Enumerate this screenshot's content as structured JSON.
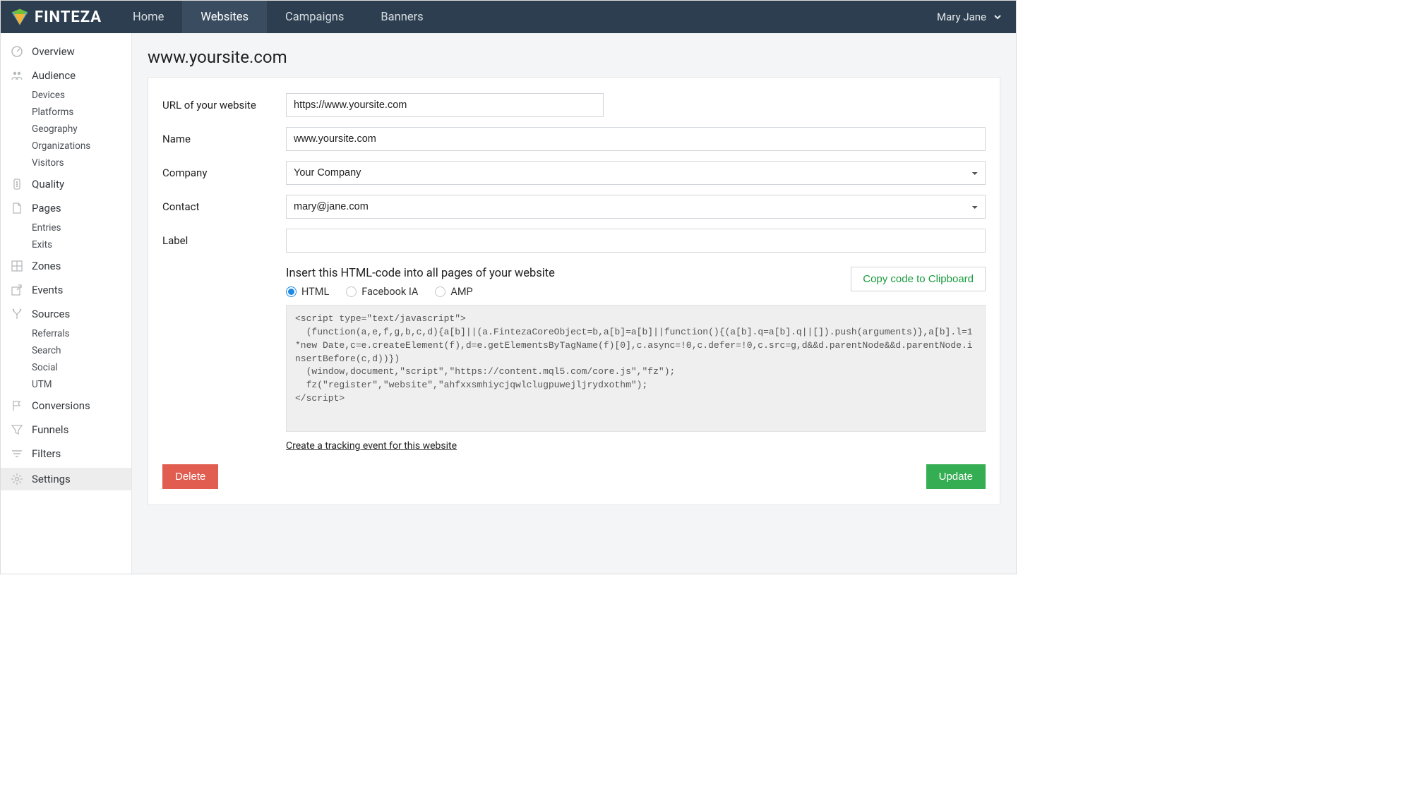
{
  "brand": "FINTEZA",
  "nav": {
    "home": "Home",
    "websites": "Websites",
    "campaigns": "Campaigns",
    "banners": "Banners"
  },
  "user": {
    "name": "Mary Jane"
  },
  "sidebar": {
    "overview": "Overview",
    "audience": "Audience",
    "audience_subs": {
      "devices": "Devices",
      "platforms": "Platforms",
      "geography": "Geography",
      "organizations": "Organizations",
      "visitors": "Visitors"
    },
    "quality": "Quality",
    "pages": "Pages",
    "pages_subs": {
      "entries": "Entries",
      "exits": "Exits"
    },
    "zones": "Zones",
    "events": "Events",
    "sources": "Sources",
    "sources_subs": {
      "referrals": "Referrals",
      "search": "Search",
      "social": "Social",
      "utm": "UTM"
    },
    "conversions": "Conversions",
    "funnels": "Funnels",
    "filters": "Filters",
    "settings": "Settings"
  },
  "page": {
    "title": "www.yoursite.com",
    "labels": {
      "url": "URL of your website",
      "name": "Name",
      "company": "Company",
      "contact": "Contact",
      "label": "Label"
    },
    "values": {
      "url": "https://www.yoursite.com",
      "name": "www.yoursite.com",
      "company": "Your Company",
      "contact": "mary@jane.com",
      "label": ""
    },
    "code": {
      "caption": "Insert this HTML-code into all pages of your website",
      "radios": {
        "html": "HTML",
        "fbia": "Facebook IA",
        "amp": "AMP"
      },
      "copy": "Copy code to Clipboard",
      "snippet": "<script type=\"text/javascript\">\n  (function(a,e,f,g,b,c,d){a[b]||(a.FintezaCoreObject=b,a[b]=a[b]||function(){(a[b].q=a[b].q||[]).push(arguments)},a[b].l=1*new Date,c=e.createElement(f),d=e.getElementsByTagName(f)[0],c.async=!0,c.defer=!0,c.src=g,d&&d.parentNode&&d.parentNode.insertBefore(c,d))})\n  (window,document,\"script\",\"https://content.mql5.com/core.js\",\"fz\");\n  fz(\"register\",\"website\",\"ahfxxsmhiycjqwlclugpuwejljrydxothm\");\n</script>",
      "tracklink": "Create a tracking event for this website"
    },
    "actions": {
      "delete": "Delete",
      "update": "Update"
    }
  }
}
